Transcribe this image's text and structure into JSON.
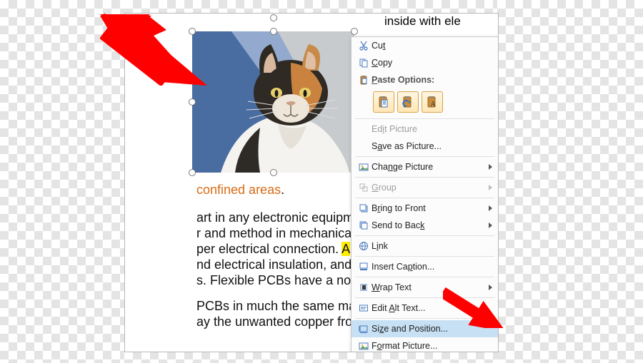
{
  "doc": {
    "top_fragment": "inside with ele",
    "confined": "confined areas",
    "confined_end": ".",
    "l1": "art in any electronic equipm",
    "l2": "r and method in mechanical",
    "l3a": "per electrical connection. ",
    "l3b": "A",
    "l4": "nd electrical insulation, and",
    "l5": "s. Flexible PCBs have a nor",
    "l6": "PCBs in much the same ma",
    "l7": "ay the unwanted copper fro"
  },
  "menu": {
    "cut": {
      "label": "Cut",
      "hotkey_index": 2
    },
    "copy": {
      "label": "Copy"
    },
    "paste_header": {
      "label": "Paste Options:"
    },
    "edit_picture": {
      "label": "Edit Picture"
    },
    "save_as": {
      "label": "Save as Picture..."
    },
    "change_picture": {
      "label": "Change Picture"
    },
    "group": {
      "label": "Group"
    },
    "bring_front": {
      "label": "Bring to Front"
    },
    "send_back": {
      "label": "Send to Back"
    },
    "link": {
      "label": "Link"
    },
    "insert_caption": {
      "label": "Insert Caption..."
    },
    "wrap_text": {
      "label": "Wrap Text"
    },
    "edit_alt": {
      "label": "Edit Alt Text..."
    },
    "size_pos": {
      "label": "Size and Position..."
    },
    "format_pic": {
      "label": "Format Picture..."
    }
  },
  "paste_options": [
    "keep-source",
    "merge",
    "text-only"
  ],
  "colors": {
    "menu_hover": "#c7e0f4",
    "highlight": "#ffee00",
    "link_orange": "#d86c17",
    "arrow_red": "#ff0000"
  }
}
